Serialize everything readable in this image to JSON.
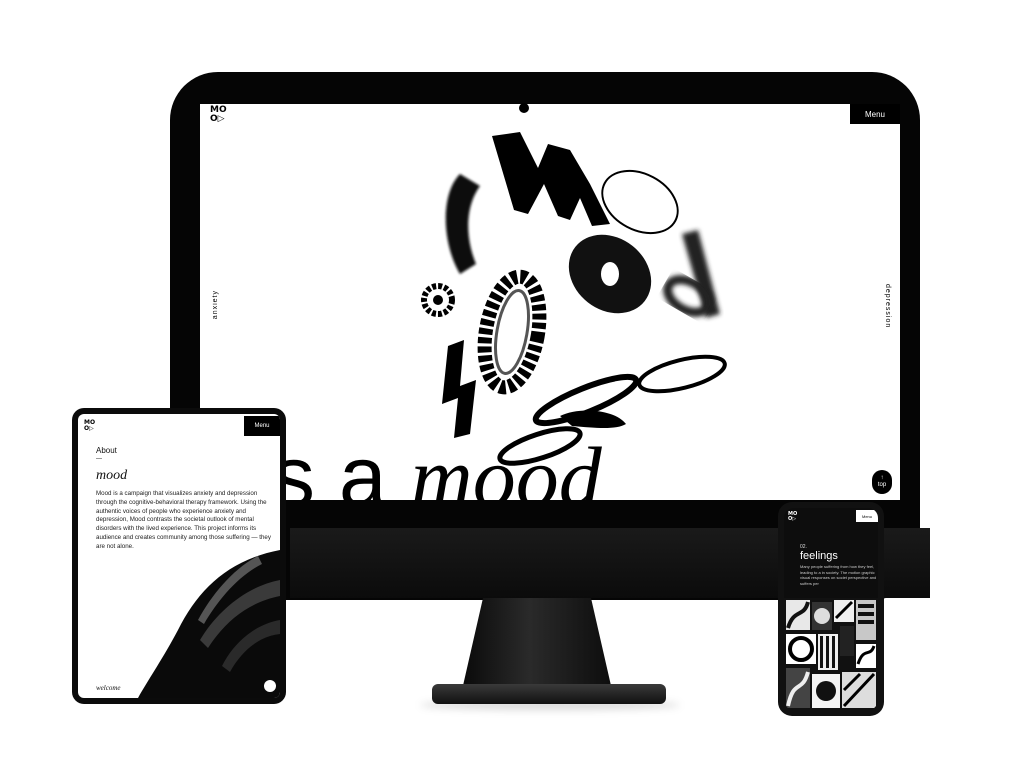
{
  "desktop": {
    "logo_top": "MO",
    "logo_bottom": "O▷",
    "menu_label": "Menu",
    "side_left": "anxiety",
    "side_right": "depression",
    "headline_plain": "s a ",
    "headline_italic": "mood",
    "top_button_arrow": "↑",
    "top_button_label": "top"
  },
  "tablet": {
    "logo_top": "MO",
    "logo_bottom": "O▷",
    "menu_label": "Menu",
    "section_label": "About",
    "dash": "—",
    "title": "mood",
    "body": "Mood is a campaign that visualizes anxiety and depression through the cognitive-behavioral therapy framework. Using the authentic voices of people who experience anxiety and depression, Mood contrasts the societal outlook of mental disorders with the lived experience. This project informs its audience and creates community among those suffering — they are not alone.",
    "footer_word": "welcome"
  },
  "phone": {
    "logo_top": "MO",
    "logo_bottom": "O▷",
    "menu_label": "Menu",
    "section_number": "02.",
    "section_title": "feelings",
    "body": "Many people suffering from how they feel, leading to a in society. The motion graphic visual responses on societ perspective and suffers per"
  },
  "colors": {
    "device_black": "#050505",
    "screen_white": "#ffffff",
    "ink": "#000000"
  }
}
